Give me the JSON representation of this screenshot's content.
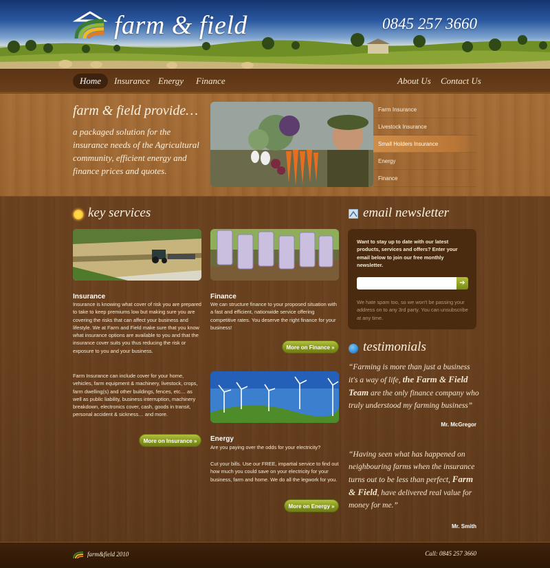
{
  "header": {
    "brand": "farm & field",
    "phone": "0845 257 3660"
  },
  "nav": {
    "left": [
      "Home",
      "Insurance",
      "Energy",
      "Finance"
    ],
    "right": [
      "About Us",
      "Contact Us"
    ],
    "active": "Home"
  },
  "hero": {
    "title": "farm & field provide…",
    "text": "a packaged solution for the insurance needs of the Agricultural community, efficient energy and finance prices and quotes.",
    "menu": [
      "Farm Insurance",
      "Livestock Insurance",
      "Small Holders Insurance",
      "Energy",
      "Finance"
    ],
    "menu_active": "Small Holders Insurance"
  },
  "key_services": {
    "title": "key services",
    "insurance": {
      "title": "Insurance",
      "text1": "Insurance is knowing what cover of risk you are prepared to take to keep premiums low but making sure you are covering the risks that can affect your business and lifestyle. We at Farm and Field make sure that you know what insurance options are available to you and that the insurance cover suits you thus reducing the risk or exposure to you and your business.",
      "text2": "Farm Insurance can include cover for your home, vehicles, farm equipment & machinery, livestock, crops, farm dwelling(s) and other buildings, fences, etc… as well as public liability, business interruption, machinery breakdown, electronics cover, cash, goods in transit, personal accident & sickness… and more.",
      "button": "More on Insurance »"
    },
    "finance": {
      "title": "Finance",
      "text": "We can structure finance to your proposed situation with a fast and efficient, nationwide service offering competitive rates. You deserve the right finance for your business!",
      "button": "More on Finance »"
    },
    "energy": {
      "title": "Energy",
      "text1": "Are you paying over the odds for your electricity?",
      "text2": "Cut your bills. Use our FREE, impartial service to find out how much you could save on your electricity for your business, farm and home. We do all the legwork for you.",
      "button": "More on Energy »"
    }
  },
  "newsletter": {
    "title": "email newsletter",
    "text": "Want to stay up to date with our latest products, services and offers? Enter your email below to join our free monthly newsletter.",
    "input_value": "",
    "submit_label": "➔",
    "spam_text": "We hate spam too, so we won't be passing your address on to any 3rd party. You can unsubscribe at any time."
  },
  "testimonials": {
    "title": "testimonials",
    "items": [
      {
        "quote_a": "“Farming is more than just a business it's a way of life, ",
        "highlight": "the Farm & Field Team",
        "quote_b": " are the only finance company who truly understood my farming business”",
        "author": "Mr. McGregor"
      },
      {
        "quote_a": "“Having seen what has happened on neighbouring farms when the insurance turns out to be less than perfect, ",
        "highlight": "Farm & Field",
        "quote_b": ", have delivered real value for money for me.”",
        "author": "Mr. Smith"
      }
    ]
  },
  "footer": {
    "brand": "farm&field 2010",
    "call": "Call: 0845 257 3660"
  },
  "colors": {
    "sky": "#2a58a0",
    "wood": "#6d4421",
    "hero_wood": "#a46c36",
    "button_green": "#869620",
    "active_menu": "#cf8e48"
  }
}
